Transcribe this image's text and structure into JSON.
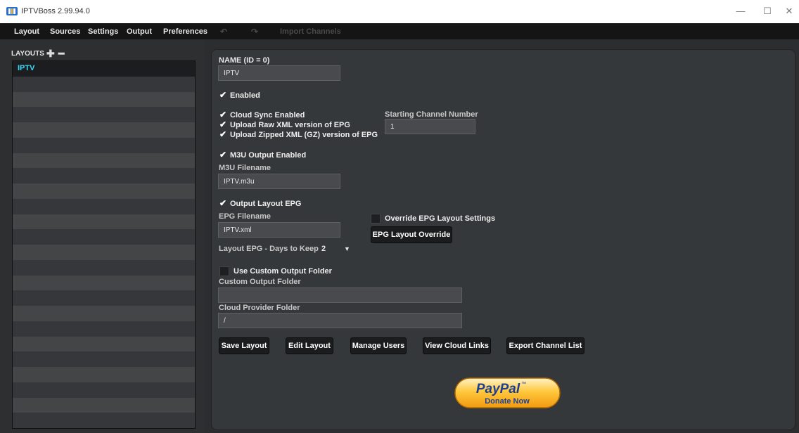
{
  "window": {
    "title": "IPTVBoss 2.99.94.0",
    "minimize": "—",
    "maximize": "☐",
    "close": "✕"
  },
  "menu": {
    "items": [
      "Layout",
      "Sources",
      "Settings",
      "Output",
      "Preferences"
    ],
    "undo": "↶",
    "redo": "↷",
    "import": "Import Channels"
  },
  "layouts": {
    "title": "LAYOUTS",
    "add": "✚",
    "remove": "━",
    "items": [
      "IPTV"
    ]
  },
  "form": {
    "name_label": "NAME (ID = 0)",
    "name_value": "IPTV",
    "enabled": "Enabled",
    "cloud_sync": "Cloud Sync Enabled",
    "upload_raw": "Upload Raw XML version of EPG",
    "upload_zip": "Upload Zipped XML (GZ) version of EPG",
    "start_label": "Starting Channel Number",
    "start_value": "1",
    "m3u_enabled": "M3U Output Enabled",
    "m3u_label": "M3U Filename",
    "m3u_value": "IPTV.m3u",
    "output_epg": "Output Layout EPG",
    "epg_label": "EPG Filename",
    "epg_value": "IPTV.xml",
    "override_label": "Override EPG Layout Settings",
    "override_button": "EPG Layout Override",
    "days_label": "Layout EPG - Days to Keep",
    "days_value": "2",
    "custom_folder_check": "Use Custom Output Folder",
    "custom_folder_label": "Custom Output Folder",
    "custom_folder_value": "",
    "cloud_folder_label": "Cloud Provider Folder",
    "cloud_folder_value": "/"
  },
  "buttons": {
    "save": "Save Layout",
    "edit": "Edit Layout",
    "users": "Manage Users",
    "links": "View Cloud Links",
    "export": "Export Channel List"
  },
  "paypal": {
    "brand": "PayPal",
    "tm": "™",
    "action": "Donate Now"
  },
  "colors": {
    "accent_selected": "#38d8f8",
    "panel": "#35383a",
    "button": "#1b1c1d"
  }
}
